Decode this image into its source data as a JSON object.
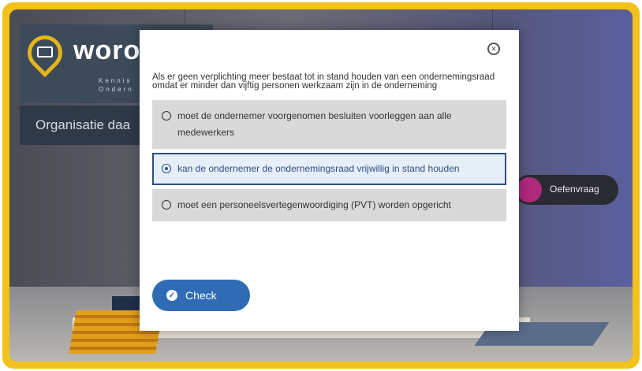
{
  "background": {
    "logo_word": "woro",
    "logo_subtitle_1": "Kennis",
    "logo_subtitle_2": "Ondern",
    "org_banner": "Organisatie daa",
    "practice_pill": "Oefenvraag"
  },
  "modal": {
    "question": "Als er geen verplichting meer bestaat tot in stand houden van een ondernemingsraad omdat er minder dan vijftig personen werkzaam zijn in de onderneming",
    "options": [
      {
        "label": "moet de ondernemer voorgenomen besluiten voorleggen aan alle medewerkers",
        "selected": false
      },
      {
        "label": "kan de ondernemer de ondernemingsraad vrijwillig in stand houden",
        "selected": true
      },
      {
        "label": "moet een personeelsvertegenwoordiging (PVT) worden opgericht",
        "selected": false
      }
    ],
    "check_label": "Check",
    "close_symbol": "✕"
  },
  "colors": {
    "frame": "#f2c21a",
    "accent_button": "#2f6cb5",
    "selected_border": "#2f4f86",
    "pill_dot": "#b0297c"
  }
}
